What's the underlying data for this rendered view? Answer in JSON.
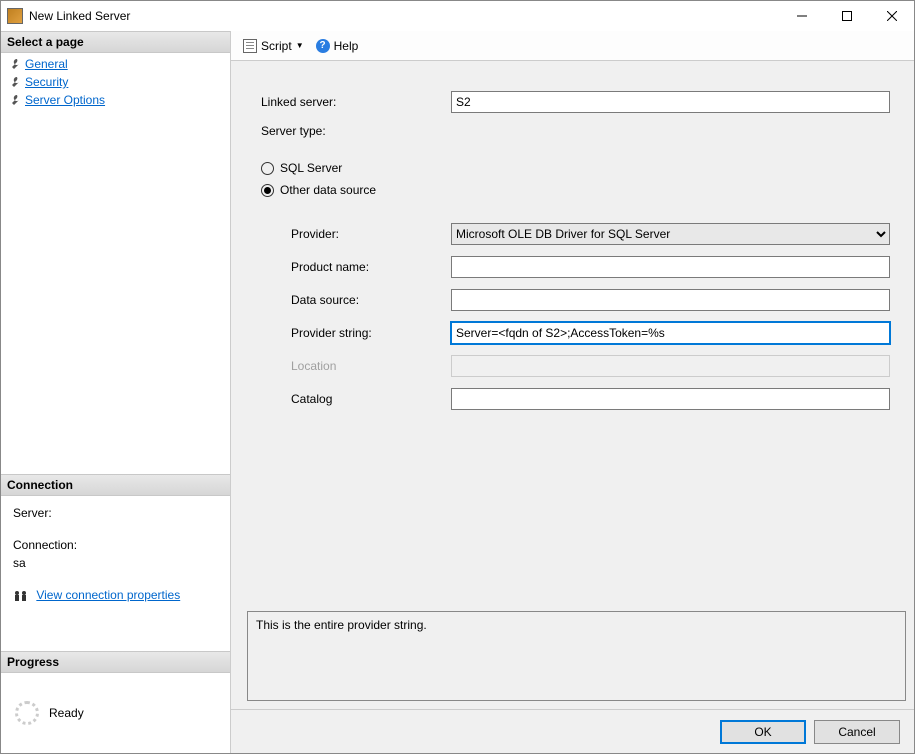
{
  "window": {
    "title": "New Linked Server"
  },
  "sidebar": {
    "select_page_header": "Select a page",
    "pages": [
      {
        "label": "General"
      },
      {
        "label": "Security"
      },
      {
        "label": "Server Options"
      }
    ],
    "connection_header": "Connection",
    "server_label": "Server:",
    "server_value": "",
    "connection_label": "Connection:",
    "connection_value": "sa",
    "view_props": "View connection properties",
    "progress_header": "Progress",
    "progress_status": "Ready"
  },
  "toolbar": {
    "script_label": "Script",
    "help_label": "Help"
  },
  "form": {
    "linked_server_label": "Linked server:",
    "linked_server_value": "S2",
    "server_type_label": "Server type:",
    "radio_sql": "SQL Server",
    "radio_other": "Other data source",
    "provider_label": "Provider:",
    "provider_value": "Microsoft OLE DB Driver for SQL Server",
    "product_label": "Product name:",
    "product_value": "",
    "datasource_label": "Data source:",
    "datasource_value": "",
    "provstr_label": "Provider string:",
    "provstr_value": "Server=<fqdn of S2>;AccessToken=%s",
    "location_label": "Location",
    "location_value": "",
    "catalog_label": "Catalog",
    "catalog_value": "",
    "message": "This is the entire provider string."
  },
  "footer": {
    "ok": "OK",
    "cancel": "Cancel"
  }
}
